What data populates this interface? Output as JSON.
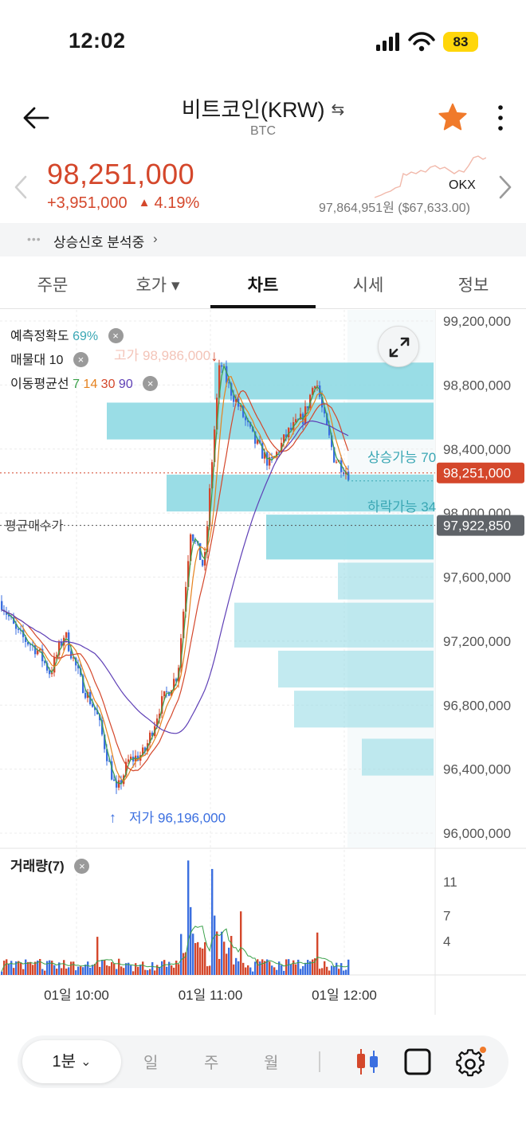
{
  "status_bar": {
    "time": "12:02",
    "battery": "83"
  },
  "header": {
    "title": "비트코인(KRW)",
    "swap_symbol": "⇆",
    "subtitle": "BTC"
  },
  "price": {
    "current": "98,251,000",
    "change_amount": "+3,951,000",
    "change_triangle": "▲",
    "change_percent": "4.19%",
    "exchange": "OKX",
    "exchange_price": "97,864,951원 ($67,633.00)"
  },
  "signal": {
    "text": "상승신호 분석중",
    "chevron": "›"
  },
  "tabs": [
    {
      "label": "주문"
    },
    {
      "label": "호가 ▾"
    },
    {
      "label": "차트"
    },
    {
      "label": "시세"
    },
    {
      "label": "정보"
    }
  ],
  "legend": {
    "accuracy_label": "예측정확도",
    "accuracy_value": "69%",
    "volume_profile_label": "매물대",
    "volume_profile_value": "10",
    "ma_label": "이동평균선",
    "ma_periods": [
      "7",
      "14",
      "30",
      "90"
    ],
    "close_symbol": "×"
  },
  "chart_data": {
    "type": "candlestick",
    "y_axis_ticks": [
      "99,200,000",
      "98,800,000",
      "98,400,000",
      "98,000,000",
      "97,600,000",
      "97,200,000",
      "96,800,000",
      "96,400,000",
      "96,000,000"
    ],
    "ylim": [
      96000000,
      99200000
    ],
    "x_axis_ticks": [
      "01일 10:00",
      "01일 11:00",
      "01일 12:00"
    ],
    "current_price_label": "98,251,000",
    "avg_buy_price_label": "97,922,850",
    "avg_buy_label": "평균매수가",
    "high_label": "고가 98,986,000",
    "low_label": "저가 96,196,000",
    "rise_possible_label": "상승가능 70",
    "fall_possible_label": "하락가능 34",
    "volume_title": "거래량(7)",
    "volume_ticks": [
      "11",
      "7",
      "4"
    ],
    "volume_profile_levels": [
      {
        "low": 98450000,
        "high": 98700000,
        "strength": 0.82
      },
      {
        "low": 98700000,
        "high": 98950000,
        "strength": 0.55
      },
      {
        "low": 98000000,
        "high": 98250000,
        "strength": 0.67
      },
      {
        "low": 97700000,
        "high": 98000000,
        "strength": 0.42
      },
      {
        "low": 97450000,
        "high": 97700000,
        "strength": 0.24
      },
      {
        "low": 97150000,
        "high": 97450000,
        "strength": 0.5
      },
      {
        "low": 96900000,
        "high": 97150000,
        "strength": 0.39
      },
      {
        "low": 96650000,
        "high": 96900000,
        "strength": 0.35
      },
      {
        "low": 96350000,
        "high": 96600000,
        "strength": 0.18
      }
    ],
    "colors": {
      "up": "#d4472b",
      "down": "#3b6fe0",
      "ma7": "#3aa14a",
      "ma14": "#e6821e",
      "ma30": "#d4472b",
      "ma90": "#5e3fb6",
      "profile": "#8fd9e3"
    }
  },
  "toolbar": {
    "interval": "1분",
    "interval_chevron": "⌄",
    "periods": [
      "일",
      "주",
      "월"
    ]
  }
}
